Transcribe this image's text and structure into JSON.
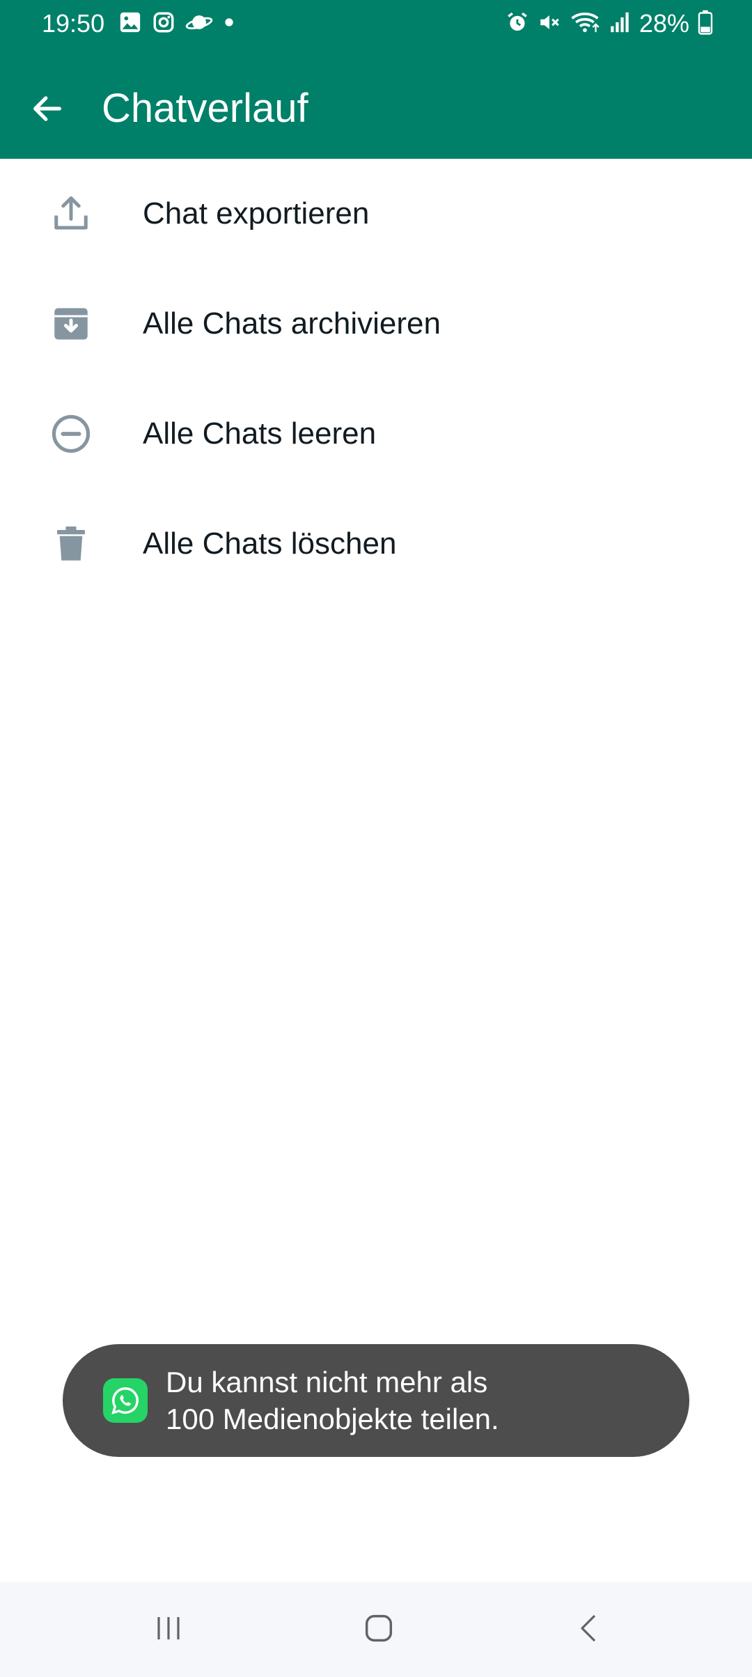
{
  "status_bar": {
    "time": "19:50",
    "battery_percent": "28%",
    "battery_level": 0.28,
    "left_icons": [
      "gallery-icon",
      "instagram-icon",
      "planet-icon",
      "dot-icon"
    ],
    "right_icons": [
      "alarm-icon",
      "mute-icon",
      "wifi-icon",
      "signal-icon",
      "battery-icon"
    ]
  },
  "app_bar": {
    "title": "Chatverlauf",
    "back_icon": "arrow-back-icon"
  },
  "menu": {
    "items": [
      {
        "label": "Chat exportieren",
        "icon": "export-icon"
      },
      {
        "label": "Alle Chats archivieren",
        "icon": "archive-icon"
      },
      {
        "label": "Alle Chats leeren",
        "icon": "clear-icon"
      },
      {
        "label": "Alle Chats löschen",
        "icon": "trash-icon"
      }
    ]
  },
  "toast": {
    "app_icon": "whatsapp-icon",
    "line1": "Du kannst nicht mehr als",
    "line2": "100 Medienobjekte teilen."
  },
  "nav_bar": {
    "buttons": [
      "recents-icon",
      "home-icon",
      "back-icon"
    ]
  },
  "colors": {
    "app_bar": "#008069",
    "icon_grey": "#8696a0",
    "toast_bg": "#4d4d4d",
    "whatsapp_green": "#25d366",
    "nav_bg": "#f6f7fb"
  }
}
